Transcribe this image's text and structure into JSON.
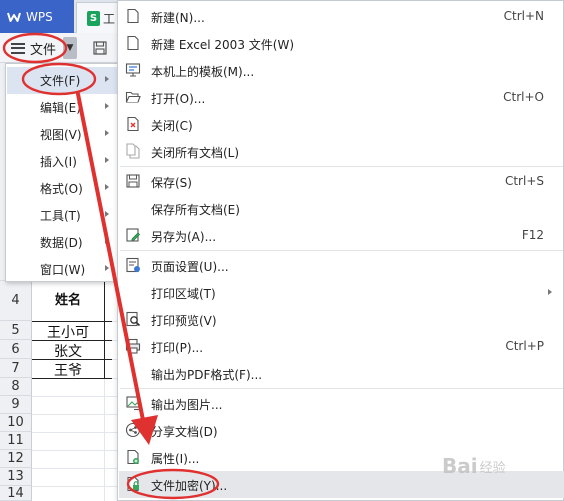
{
  "titlebar": {
    "app_tab": "WPS",
    "doc_tab_icon": "S",
    "doc_tab_label": "工"
  },
  "toolbar": {
    "file_label": "文件",
    "file_dropdown_icon": "chevron-down-icon",
    "save_icon": "save-icon"
  },
  "left_menu": {
    "items": [
      {
        "label": "文件(F)",
        "has_submenu": true,
        "active": true
      },
      {
        "label": "编辑(E)",
        "has_submenu": true
      },
      {
        "label": "视图(V)",
        "has_submenu": true
      },
      {
        "label": "插入(I)",
        "has_submenu": true
      },
      {
        "label": "格式(O)",
        "has_submenu": true
      },
      {
        "label": "工具(T)",
        "has_submenu": true
      },
      {
        "label": "数据(D)",
        "has_submenu": true
      },
      {
        "label": "窗口(W)",
        "has_submenu": true
      }
    ]
  },
  "main_menu": {
    "items": [
      {
        "label": "新建(N)...",
        "shortcut": "Ctrl+N",
        "icon": "new-file-icon"
      },
      {
        "label": "新建 Excel 2003 文件(W)",
        "shortcut": "",
        "icon": "new-file-icon"
      },
      {
        "label": "本机上的模板(M)...",
        "shortcut": "",
        "icon": "template-icon"
      },
      {
        "label": "打开(O)...",
        "shortcut": "Ctrl+O",
        "icon": "folder-open-icon"
      },
      {
        "label": "关闭(C)",
        "shortcut": "",
        "icon": "close-doc-icon"
      },
      {
        "label": "关闭所有文档(L)",
        "shortcut": "",
        "icon": "close-all-icon"
      },
      {
        "label": "保存(S)",
        "shortcut": "Ctrl+S",
        "icon": "save-icon"
      },
      {
        "label": "保存所有文档(E)",
        "shortcut": "",
        "icon": ""
      },
      {
        "label": "另存为(A)...",
        "shortcut": "F12",
        "icon": "save-as-icon"
      },
      {
        "label": "页面设置(U)...",
        "shortcut": "",
        "icon": "page-setup-icon"
      },
      {
        "label": "打印区域(T)",
        "shortcut": "",
        "icon": "",
        "has_submenu": true
      },
      {
        "label": "打印预览(V)",
        "shortcut": "",
        "icon": "print-preview-icon"
      },
      {
        "label": "打印(P)...",
        "shortcut": "Ctrl+P",
        "icon": "print-icon"
      },
      {
        "label": "输出为PDF格式(F)...",
        "shortcut": "",
        "icon": ""
      },
      {
        "label": "输出为图片...",
        "shortcut": "",
        "icon": "export-image-icon"
      },
      {
        "label": "分享文档(D)",
        "shortcut": "",
        "icon": "share-icon"
      },
      {
        "label": "属性(I)...",
        "shortcut": "",
        "icon": "properties-icon"
      },
      {
        "label": "文件加密(Y)...",
        "shortcut": "",
        "icon": "encrypt-icon",
        "highlighted": true
      }
    ]
  },
  "sheet": {
    "row_numbers": [
      "4",
      "5",
      "6",
      "7",
      "8",
      "9",
      "10",
      "11",
      "12",
      "13",
      "14"
    ],
    "header_cell": "姓名",
    "names": [
      "王小可",
      "张文",
      "王爷"
    ]
  },
  "watermark": {
    "logo": "Bai",
    "subtitle": "经验"
  },
  "colors": {
    "annotation_red": "#e03131",
    "wps_blue": "#3b64c8",
    "sheet_green": "#1aa35a",
    "menu_highlight": "#e4e6ea",
    "left_active": "#dbe4f0"
  }
}
